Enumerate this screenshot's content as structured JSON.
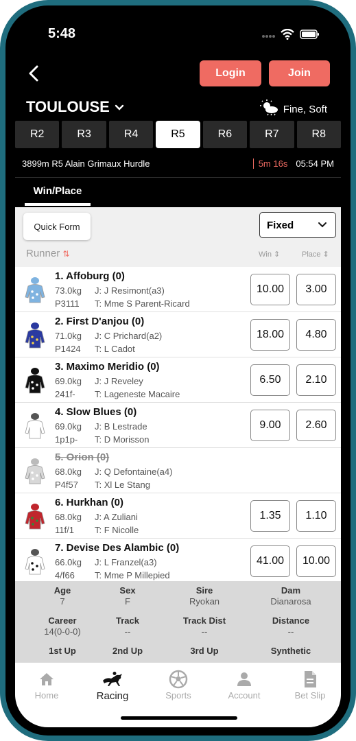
{
  "status": {
    "time": "5:48"
  },
  "header": {
    "login_label": "Login",
    "join_label": "Join"
  },
  "venue": {
    "name": "TOULOUSE",
    "weather": "Fine, Soft"
  },
  "race_tabs": [
    "R2",
    "R3",
    "R4",
    "R5",
    "R6",
    "R7",
    "R8"
  ],
  "active_race_tab": "R5",
  "race_info": {
    "description": "3899m R5 Alain Grimaux Hurdle",
    "countdown": "5m 16s",
    "time": "05:54 PM"
  },
  "bet_tab": "Win/Place",
  "controls": {
    "quick_form": "Quick Form",
    "price_type": "Fixed"
  },
  "columns": {
    "runner": "Runner",
    "win": "Win",
    "place": "Place"
  },
  "runners": [
    {
      "name": "1. Affoburg (0)",
      "weight": "73.0kg",
      "jockey": "J: J Resimont(a3)",
      "form": "P3111",
      "trainer": "T: Mme S Parent-Ricard",
      "win": "10.00",
      "place": "3.00",
      "scratched": false
    },
    {
      "name": "2. First D'anjou (0)",
      "weight": "71.0kg",
      "jockey": "J: C Prichard(a2)",
      "form": "P1424",
      "trainer": "T: L Cadot",
      "win": "18.00",
      "place": "4.80",
      "scratched": false
    },
    {
      "name": "3. Maximo Meridio (0)",
      "weight": "69.0kg",
      "jockey": "J: J Reveley",
      "form": "241f-",
      "trainer": "T: Lageneste Macaire",
      "win": "6.50",
      "place": "2.10",
      "scratched": false
    },
    {
      "name": "4. Slow Blues (0)",
      "weight": "69.0kg",
      "jockey": "J: B Lestrade",
      "form": "1p1p-",
      "trainer": "T: D Morisson",
      "win": "9.00",
      "place": "2.60",
      "scratched": false
    },
    {
      "name": "5. Orion (0)",
      "weight": "68.0kg",
      "jockey": "J: Q Defontaine(a4)",
      "form": "P4f57",
      "trainer": "T: Xl Le Stang",
      "win": "",
      "place": "",
      "scratched": true
    },
    {
      "name": "6. Hurkhan (0)",
      "weight": "68.0kg",
      "jockey": "J: A Zuliani",
      "form": "11f/1",
      "trainer": "T: F Nicolle",
      "win": "1.35",
      "place": "1.10",
      "scratched": false
    },
    {
      "name": "7. Devise Des Alambic (0)",
      "weight": "66.0kg",
      "jockey": "J: L Franzel(a3)",
      "form": "4/f66",
      "trainer": "T: Mme P Millepied",
      "win": "41.00",
      "place": "10.00",
      "scratched": false
    }
  ],
  "silk_colors": [
    "#7fb3e0",
    "#2b3aa0",
    "#111111",
    "#ffffff",
    "#d8d8d8",
    "#c0262d",
    "#ffffff"
  ],
  "stats": {
    "age": {
      "label": "Age",
      "value": "7"
    },
    "sex": {
      "label": "Sex",
      "value": "F"
    },
    "sire": {
      "label": "Sire",
      "value": "Ryokan"
    },
    "dam": {
      "label": "Dam",
      "value": "Dianarosa"
    },
    "career": {
      "label": "Career",
      "value": "14(0-0-0)"
    },
    "track": {
      "label": "Track",
      "value": "--"
    },
    "track_dist": {
      "label": "Track Dist",
      "value": "--"
    },
    "distance": {
      "label": "Distance",
      "value": "--"
    },
    "first_up": {
      "label": "1st Up"
    },
    "second_up": {
      "label": "2nd Up"
    },
    "third_up": {
      "label": "3rd Up"
    },
    "synthetic": {
      "label": "Synthetic"
    }
  },
  "nav": {
    "home": "Home",
    "racing": "Racing",
    "sports": "Sports",
    "account": "Account",
    "bet_slip": "Bet Slip"
  },
  "accent_color": "#ef6b62"
}
